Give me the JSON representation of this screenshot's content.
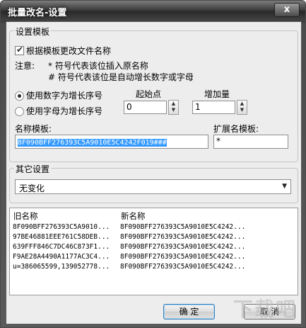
{
  "window": {
    "title": "批量改名-设置",
    "close_label": "x"
  },
  "template_group": {
    "title": "设置模板",
    "use_template_checkbox": {
      "label": "根据模板更改文件名称",
      "checked": true
    },
    "note_label": "注意:",
    "note_line1": "* 符号代表该位插入原名称",
    "note_line2": "# 符号代表该位是自动增长数字或字母",
    "radio_number": {
      "label": "使用数字为增长序号",
      "selected": true
    },
    "radio_letter": {
      "label": "使用字母为增长序号",
      "selected": false
    },
    "start_label": "起始点",
    "start_value": "0",
    "increment_label": "增加量",
    "increment_value": "1",
    "name_template_label": "名称模板:",
    "name_template_value": "8F090BFF276393C5A9010E5C4242F019###",
    "ext_template_label": "扩展名模板:",
    "ext_template_value": "*"
  },
  "other_group": {
    "title": "其它设置",
    "select_value": "无变化"
  },
  "preview": {
    "col_old": "旧名称",
    "col_new": "新名称",
    "rows": [
      {
        "old": "8F090BFF276393C5A9010...",
        "new": "8F090BFF276393C5A9010E5C4242..."
      },
      {
        "old": "97BE46881EEE761C58DEB...",
        "new": "8F090BFF276393C5A9010E5C4242..."
      },
      {
        "old": "639FFF846C7DC46C873F1...",
        "new": "8F090BFF276393C5A9010E5C4242..."
      },
      {
        "old": "F9AE28A4490A1177AC3C4...",
        "new": "8F090BFF276393C5A9010E5C4242..."
      },
      {
        "old": "u=386065599,139052778...",
        "new": "8F090BFF276393C5A9010E5C4242..."
      }
    ]
  },
  "buttons": {
    "ok": "确 定",
    "cancel": "取 消"
  },
  "watermark": "下载吧",
  "colors": {
    "selection": "#3399ff",
    "title_bar": "#3f3f3f"
  }
}
